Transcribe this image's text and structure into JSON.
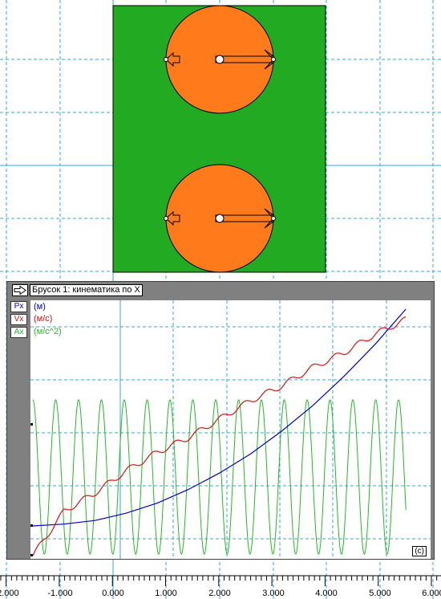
{
  "colors": {
    "grid": "#33aadd",
    "body": "#22aa22",
    "wheel": "#ff7a1a",
    "position": "#0000cc",
    "velocity": "#dd1111",
    "acceleration": "#22bb22",
    "window": "#808080"
  },
  "graph_window": {
    "title": "Брусок 1: кинематика по X",
    "title_icon": "arrow-right-icon",
    "legend": [
      {
        "key": "Px",
        "unit": "(м)",
        "color": "#0000cc"
      },
      {
        "key": "Vx",
        "unit": "(м/с)",
        "color": "#dd1111"
      },
      {
        "key": "Ax",
        "unit": "(м/с^2)",
        "color": "#22bb22"
      }
    ],
    "time_unit": "(с)"
  },
  "ruler": {
    "labels": [
      "-2.000",
      "-1.000",
      "0.000",
      "1.000",
      "2.000",
      "3.000",
      "4.000",
      "5.000",
      "6.000"
    ]
  },
  "chart_data": {
    "type": "line",
    "title": "Брусок 1: кинематика по X",
    "xlabel": "(с)",
    "xlim": [
      -0.5,
      5.6
    ],
    "series": [
      {
        "name": "Px",
        "unit": "(м)",
        "x": [
          -0.5,
          0,
          0.5,
          1,
          1.5,
          2,
          2.5,
          3,
          3.5,
          4,
          4.5,
          5,
          5.5
        ],
        "values": [
          0,
          0.02,
          0.06,
          0.14,
          0.25,
          0.4,
          0.58,
          0.79,
          1.04,
          1.32,
          1.64,
          1.99,
          2.38
        ]
      },
      {
        "name": "Vx",
        "unit": "(м/с)",
        "x": [
          -0.5,
          0,
          0.5,
          1,
          1.5,
          2,
          2.5,
          3,
          3.5,
          4,
          4.5,
          5,
          5.5
        ],
        "values": [
          0,
          0.6,
          0.85,
          1.15,
          1.4,
          1.6,
          1.85,
          2.1,
          2.3,
          2.55,
          2.75,
          3.0,
          3.2
        ]
      },
      {
        "name": "Ax",
        "unit": "(м/с^2)",
        "x": [
          -0.5,
          5.5
        ],
        "values": [
          0,
          0
        ],
        "oscillation": {
          "amplitude": 1,
          "frequency": 2.72,
          "cycles": 16.5
        }
      }
    ]
  }
}
